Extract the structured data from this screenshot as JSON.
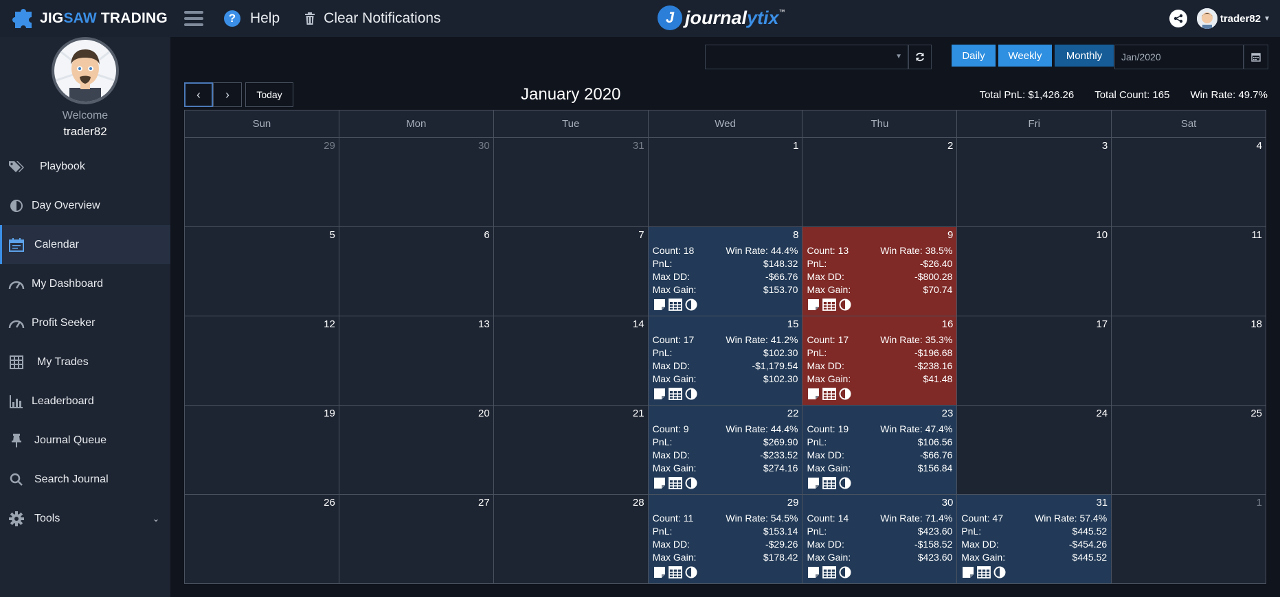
{
  "brand": {
    "jig": "JIG",
    "saw": "SAW",
    "trading": "TRADING"
  },
  "topbar": {
    "help_label": "Help",
    "clear_label": "Clear Notifications",
    "logo_journal": "journal",
    "logo_ytix": "ytix",
    "logo_tm": "™",
    "username": "trader82"
  },
  "sidebar": {
    "welcome": "Welcome",
    "username": "trader82",
    "items": [
      {
        "label": "Playbook",
        "icon": "tags-icon"
      },
      {
        "label": "Day Overview",
        "icon": "half-circle-icon"
      },
      {
        "label": "Calendar",
        "icon": "calendar-icon",
        "active": true
      },
      {
        "label": "My Dashboard",
        "icon": "gauge-icon"
      },
      {
        "label": "Profit Seeker",
        "icon": "gauge-icon"
      },
      {
        "label": "My Trades",
        "icon": "grid-icon"
      },
      {
        "label": "Leaderboard",
        "icon": "bar-chart-icon"
      },
      {
        "label": "Journal Queue",
        "icon": "pin-icon"
      },
      {
        "label": "Search Journal",
        "icon": "search-icon"
      },
      {
        "label": "Tools",
        "icon": "gear-icon"
      }
    ]
  },
  "toolbar": {
    "select_value": "",
    "daily": "Daily",
    "weekly": "Weekly",
    "monthly": "Monthly",
    "active_view": "Monthly",
    "date_value": "Jan/2020",
    "today": "Today"
  },
  "calendar": {
    "title": "January 2020",
    "total_pnl": "Total PnL: $1,426.26",
    "total_count": "Total Count: 165",
    "win_rate": "Win Rate: 49.7%",
    "weekdays": [
      "Sun",
      "Mon",
      "Tue",
      "Wed",
      "Thu",
      "Fri",
      "Sat"
    ],
    "labels": {
      "count": "Count:",
      "win_rate": "Win Rate:",
      "pnl": "PnL:",
      "max_dd": "Max DD:",
      "max_gain": "Max Gain:"
    },
    "weeks": [
      [
        {
          "day": "29",
          "muted": true
        },
        {
          "day": "30",
          "muted": true
        },
        {
          "day": "31",
          "muted": true
        },
        {
          "day": "1"
        },
        {
          "day": "2"
        },
        {
          "day": "3"
        },
        {
          "day": "4"
        }
      ],
      [
        {
          "day": "5"
        },
        {
          "day": "6"
        },
        {
          "day": "7"
        },
        {
          "day": "8",
          "count": "18",
          "win_rate": "44.4%",
          "pnl": "$148.32",
          "max_dd": "-$66.76",
          "max_gain": "$153.70",
          "status": "win"
        },
        {
          "day": "9",
          "count": "13",
          "win_rate": "38.5%",
          "pnl": "-$26.40",
          "max_dd": "-$800.28",
          "max_gain": "$70.74",
          "status": "loss"
        },
        {
          "day": "10"
        },
        {
          "day": "11"
        }
      ],
      [
        {
          "day": "12"
        },
        {
          "day": "13"
        },
        {
          "day": "14"
        },
        {
          "day": "15",
          "count": "17",
          "win_rate": "41.2%",
          "pnl": "$102.30",
          "max_dd": "-$1,179.54",
          "max_gain": "$102.30",
          "status": "win"
        },
        {
          "day": "16",
          "count": "17",
          "win_rate": "35.3%",
          "pnl": "-$196.68",
          "max_dd": "-$238.16",
          "max_gain": "$41.48",
          "status": "loss"
        },
        {
          "day": "17"
        },
        {
          "day": "18"
        }
      ],
      [
        {
          "day": "19"
        },
        {
          "day": "20"
        },
        {
          "day": "21"
        },
        {
          "day": "22",
          "count": "9",
          "win_rate": "44.4%",
          "pnl": "$269.90",
          "max_dd": "-$233.52",
          "max_gain": "$274.16",
          "status": "win"
        },
        {
          "day": "23",
          "count": "19",
          "win_rate": "47.4%",
          "pnl": "$106.56",
          "max_dd": "-$66.76",
          "max_gain": "$156.84",
          "status": "win"
        },
        {
          "day": "24"
        },
        {
          "day": "25"
        }
      ],
      [
        {
          "day": "26"
        },
        {
          "day": "27"
        },
        {
          "day": "28"
        },
        {
          "day": "29",
          "count": "11",
          "win_rate": "54.5%",
          "pnl": "$153.14",
          "max_dd": "-$29.26",
          "max_gain": "$178.42",
          "status": "win"
        },
        {
          "day": "30",
          "count": "14",
          "win_rate": "71.4%",
          "pnl": "$423.60",
          "max_dd": "-$158.52",
          "max_gain": "$423.60",
          "status": "win"
        },
        {
          "day": "31",
          "count": "47",
          "win_rate": "57.4%",
          "pnl": "$445.52",
          "max_dd": "-$454.26",
          "max_gain": "$445.52",
          "status": "win"
        },
        {
          "day": "1",
          "muted": true
        }
      ]
    ]
  },
  "colors": {
    "accent": "#3b8fe6",
    "win_cell": "#223a57",
    "loss_cell": "#7f2a27",
    "button": "#2f8fe0",
    "button_active": "#165d98"
  }
}
